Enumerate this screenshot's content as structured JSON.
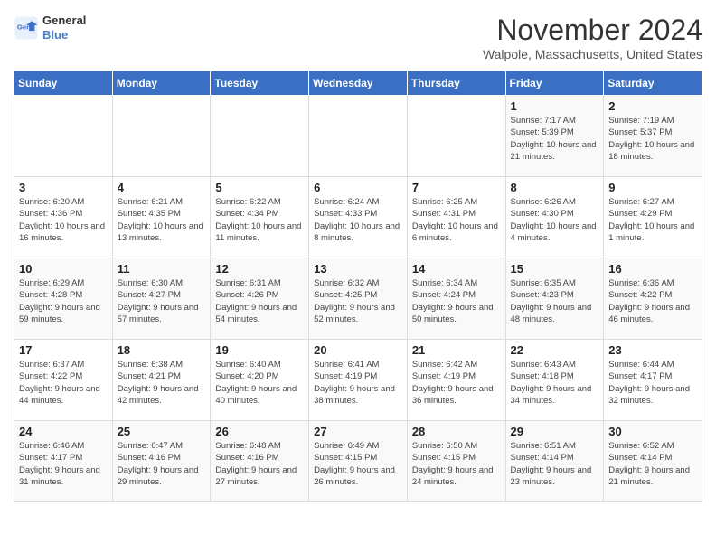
{
  "header": {
    "logo_line1": "General",
    "logo_line2": "Blue",
    "title": "November 2024",
    "location": "Walpole, Massachusetts, United States"
  },
  "days_of_week": [
    "Sunday",
    "Monday",
    "Tuesday",
    "Wednesday",
    "Thursday",
    "Friday",
    "Saturday"
  ],
  "weeks": [
    [
      {
        "day": "",
        "info": ""
      },
      {
        "day": "",
        "info": ""
      },
      {
        "day": "",
        "info": ""
      },
      {
        "day": "",
        "info": ""
      },
      {
        "day": "",
        "info": ""
      },
      {
        "day": "1",
        "info": "Sunrise: 7:17 AM\nSunset: 5:39 PM\nDaylight: 10 hours and 21 minutes."
      },
      {
        "day": "2",
        "info": "Sunrise: 7:19 AM\nSunset: 5:37 PM\nDaylight: 10 hours and 18 minutes."
      }
    ],
    [
      {
        "day": "3",
        "info": "Sunrise: 6:20 AM\nSunset: 4:36 PM\nDaylight: 10 hours and 16 minutes."
      },
      {
        "day": "4",
        "info": "Sunrise: 6:21 AM\nSunset: 4:35 PM\nDaylight: 10 hours and 13 minutes."
      },
      {
        "day": "5",
        "info": "Sunrise: 6:22 AM\nSunset: 4:34 PM\nDaylight: 10 hours and 11 minutes."
      },
      {
        "day": "6",
        "info": "Sunrise: 6:24 AM\nSunset: 4:33 PM\nDaylight: 10 hours and 8 minutes."
      },
      {
        "day": "7",
        "info": "Sunrise: 6:25 AM\nSunset: 4:31 PM\nDaylight: 10 hours and 6 minutes."
      },
      {
        "day": "8",
        "info": "Sunrise: 6:26 AM\nSunset: 4:30 PM\nDaylight: 10 hours and 4 minutes."
      },
      {
        "day": "9",
        "info": "Sunrise: 6:27 AM\nSunset: 4:29 PM\nDaylight: 10 hours and 1 minute."
      }
    ],
    [
      {
        "day": "10",
        "info": "Sunrise: 6:29 AM\nSunset: 4:28 PM\nDaylight: 9 hours and 59 minutes."
      },
      {
        "day": "11",
        "info": "Sunrise: 6:30 AM\nSunset: 4:27 PM\nDaylight: 9 hours and 57 minutes."
      },
      {
        "day": "12",
        "info": "Sunrise: 6:31 AM\nSunset: 4:26 PM\nDaylight: 9 hours and 54 minutes."
      },
      {
        "day": "13",
        "info": "Sunrise: 6:32 AM\nSunset: 4:25 PM\nDaylight: 9 hours and 52 minutes."
      },
      {
        "day": "14",
        "info": "Sunrise: 6:34 AM\nSunset: 4:24 PM\nDaylight: 9 hours and 50 minutes."
      },
      {
        "day": "15",
        "info": "Sunrise: 6:35 AM\nSunset: 4:23 PM\nDaylight: 9 hours and 48 minutes."
      },
      {
        "day": "16",
        "info": "Sunrise: 6:36 AM\nSunset: 4:22 PM\nDaylight: 9 hours and 46 minutes."
      }
    ],
    [
      {
        "day": "17",
        "info": "Sunrise: 6:37 AM\nSunset: 4:22 PM\nDaylight: 9 hours and 44 minutes."
      },
      {
        "day": "18",
        "info": "Sunrise: 6:38 AM\nSunset: 4:21 PM\nDaylight: 9 hours and 42 minutes."
      },
      {
        "day": "19",
        "info": "Sunrise: 6:40 AM\nSunset: 4:20 PM\nDaylight: 9 hours and 40 minutes."
      },
      {
        "day": "20",
        "info": "Sunrise: 6:41 AM\nSunset: 4:19 PM\nDaylight: 9 hours and 38 minutes."
      },
      {
        "day": "21",
        "info": "Sunrise: 6:42 AM\nSunset: 4:19 PM\nDaylight: 9 hours and 36 minutes."
      },
      {
        "day": "22",
        "info": "Sunrise: 6:43 AM\nSunset: 4:18 PM\nDaylight: 9 hours and 34 minutes."
      },
      {
        "day": "23",
        "info": "Sunrise: 6:44 AM\nSunset: 4:17 PM\nDaylight: 9 hours and 32 minutes."
      }
    ],
    [
      {
        "day": "24",
        "info": "Sunrise: 6:46 AM\nSunset: 4:17 PM\nDaylight: 9 hours and 31 minutes."
      },
      {
        "day": "25",
        "info": "Sunrise: 6:47 AM\nSunset: 4:16 PM\nDaylight: 9 hours and 29 minutes."
      },
      {
        "day": "26",
        "info": "Sunrise: 6:48 AM\nSunset: 4:16 PM\nDaylight: 9 hours and 27 minutes."
      },
      {
        "day": "27",
        "info": "Sunrise: 6:49 AM\nSunset: 4:15 PM\nDaylight: 9 hours and 26 minutes."
      },
      {
        "day": "28",
        "info": "Sunrise: 6:50 AM\nSunset: 4:15 PM\nDaylight: 9 hours and 24 minutes."
      },
      {
        "day": "29",
        "info": "Sunrise: 6:51 AM\nSunset: 4:14 PM\nDaylight: 9 hours and 23 minutes."
      },
      {
        "day": "30",
        "info": "Sunrise: 6:52 AM\nSunset: 4:14 PM\nDaylight: 9 hours and 21 minutes."
      }
    ]
  ]
}
